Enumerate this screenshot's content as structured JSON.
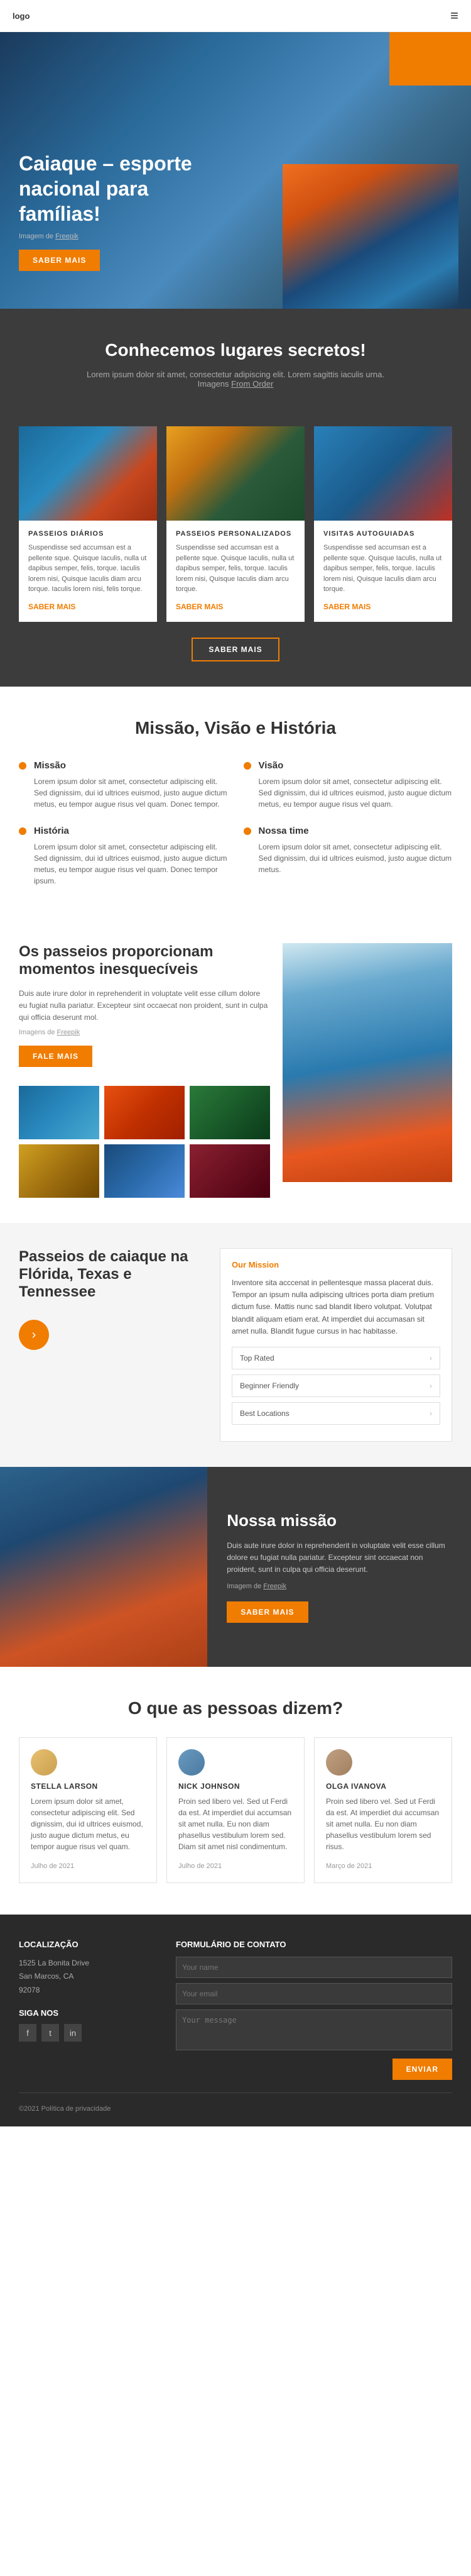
{
  "header": {
    "logo": "logo",
    "menu_icon": "≡"
  },
  "hero": {
    "title": "Caiaque – esporte nacional para famílias!",
    "image_credit": "Imagem de Freepik",
    "btn_label": "SABER MAIS"
  },
  "secret_section": {
    "title": "Conhecemos lugares secretos!",
    "text": "Lorem ipsum dolor sit amet, consectetur adipiscing elit. Lorem sagittis iaculis urna. Imagens From Order",
    "image_credit": "Imagens From Order"
  },
  "cards": [
    {
      "tag": "PASSEIOS DIÁRIOS",
      "text": "Suspendisse sed accumsan est a pellente sque. Quisque Iaculis, nulla ut dapibus semper, felis, torque. Iaculis lorem nisi, Quisque Iaculis diam arcu torque. Iaculis lorem nisi, felis torque.",
      "link": "SABER MAIS"
    },
    {
      "tag": "PASSEIOS PERSONALIZADOS",
      "text": "Suspendisse sed accumsan est a pellente sque. Quisque Iaculis, nulla ut dapibus semper, felis, torque. Iaculis lorem nisi, Quisque Iaculis diam arcu torque.",
      "link": "SABER MAIS"
    },
    {
      "tag": "VISITAS AUTOGUIADAS",
      "text": "Suspendisse sed accumsan est a pellente sque. Quisque Iaculis, nulla ut dapibus semper, felis, torque. Iaculis lorem nisi, Quisque Iaculis diam arcu torque.",
      "link": "SABER MAIS"
    }
  ],
  "cards_btn": "SABER MAIS",
  "mission": {
    "title": "Missão, Visão e História",
    "items": [
      {
        "heading": "Missão",
        "text": "Lorem ipsum dolor sit amet, consectetur adipiscing elit. Sed dignissim, dui id ultrices euismod, justo augue dictum metus, eu tempor augue risus vel quam. Donec tempor."
      },
      {
        "heading": "Visão",
        "text": "Lorem ipsum dolor sit amet, consectetur adipiscing elit. Sed dignissim, dui id ultrices euismod, justo augue dictum metus, eu tempor augue risus vel quam."
      },
      {
        "heading": "História",
        "text": "Lorem ipsum dolor sit amet, consectetur adipiscing elit. Sed dignissim, dui id ultrices euismod, justo augue dictum metus, eu tempor augue risus vel quam. Donec tempor ipsum."
      },
      {
        "heading": "Nossa time",
        "text": "Lorem ipsum dolor sit amet, consectetur adipiscing elit. Sed dignissim, dui id ultrices euismod, justo augue dictum metus."
      }
    ]
  },
  "tours": {
    "title": "Os passeios proporcionam momentos inesquecíveis",
    "text": "Duis aute irure dolor in reprehenderit in voluptate velit esse cillum dolore eu fugiat nulla pariatur. Excepteur sint occaecat non proident, sunt in culpa qui officia deserunt mol.",
    "credit": "Imagens de Freepik",
    "btn_label": "FALE MAIS"
  },
  "florida": {
    "title": "Passeios de caiaque na Flórida, Texas e Tennessee",
    "form_title": "Our Mission",
    "form_text": "Inventore sita acccenat in pellentesque massa placerat duis. Tempor an ipsum nulla adipiscing ultrices porta diam pretium dictum fuse. Mattis nunc sad blandit libero volutpat. Volutpat blandit aliquam etiam erat. At imperdiet dui accumasan sit amet nulla. Blandit fugue cursus in hac habitasse.",
    "form_fields": [
      "Top Rated",
      "Beginner Friendly",
      "Best Locations"
    ]
  },
  "mission2": {
    "title": "Nossa missão",
    "text": "Duis aute irure dolor in reprehenderit in voluptate velit esse cillum dolore eu fugiat nulla pariatur. Excepteur sint occaecat non proident, sunt in culpa qui officia deserunt.",
    "credit": "Imagem de Freepik",
    "btn_label": "SABER MAIS"
  },
  "testimonials": {
    "title": "O que as pessoas dizem?",
    "items": [
      {
        "name": "STELLA LARSON",
        "text": "Lorem ipsum dolor sit amet, consectetur adipiscing elit. Sed dignissim, dui id ultrices euismod, justo augue dictum metus, eu tempor augue risus vel quam.",
        "date": "Julho de 2021"
      },
      {
        "name": "NICK JOHNSON",
        "text": "Proin sed libero vel. Sed ut Ferdi da est. At imperdiet dui accumsan sit amet nulla. Eu non diam phasellus vestibulum lorem sed. Diam sit amet nisl condimentum.",
        "date": "Julho de 2021"
      },
      {
        "name": "OLGA IVANOVA",
        "text": "Proin sed libero vel. Sed ut Ferdi da est. At imperdiet dui accumsan sit amet nulla. Eu non diam phasellus vestibulum lorem sed risus.",
        "date": "Março de 2021"
      }
    ]
  },
  "footer": {
    "location_title": "localização",
    "address_line1": "1525 La Bonita Drive",
    "address_line2": "San Marcos, CA",
    "address_line3": "92078",
    "social_title": "Siga nos",
    "copyright": "©2021 Política de privacidade",
    "contact_title": "Formulário de Contato",
    "fields": {
      "name_placeholder": "Your name",
      "email_placeholder": "Your email",
      "message_placeholder": "Your message",
      "submit_label": "ENVIAR"
    }
  }
}
